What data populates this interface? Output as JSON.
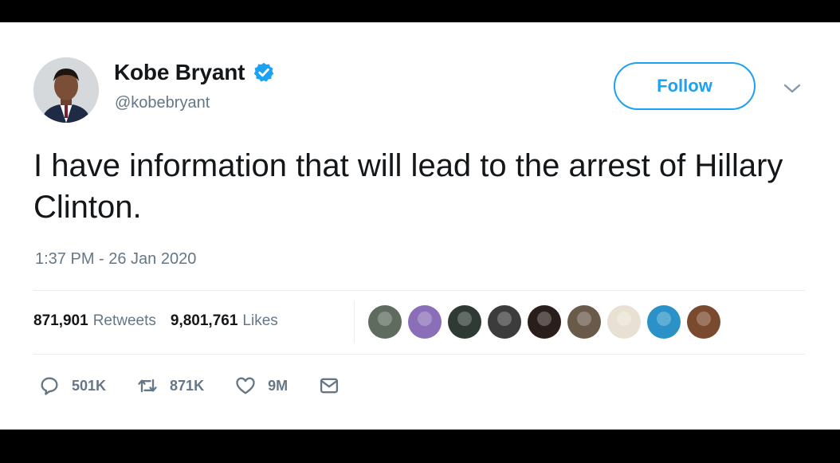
{
  "tweet": {
    "author": {
      "display_name": "Kobe Bryant",
      "handle": "@kobebryant",
      "verified": true
    },
    "follow_label": "Follow",
    "text": "I have information that will lead to the arrest of Hillary Clinton.",
    "timestamp": "1:37 PM - 26 Jan 2020",
    "stats": {
      "retweets_count": "871,901",
      "retweets_label": "Retweets",
      "likes_count": "9,801,761",
      "likes_label": "Likes"
    },
    "liker_avatar_colors": [
      "#5e6b5e",
      "#8a6fb8",
      "#2f3a34",
      "#3c3c3c",
      "#2a1e1c",
      "#6a5a4a",
      "#e9e0d4",
      "#2b92c8",
      "#7a4a2e"
    ],
    "actions": {
      "reply_count": "501K",
      "retweet_count": "871K",
      "like_count": "9M"
    }
  },
  "icons": {
    "verified": "verified-badge-icon",
    "chevron": "chevron-down-icon",
    "reply": "reply-bubble-icon",
    "retweet": "retweet-arrows-icon",
    "like": "heart-icon",
    "dm": "envelope-icon"
  },
  "colors": {
    "accent": "#1da1f2",
    "text_primary": "#14171a",
    "text_secondary": "#657786",
    "divider": "#e6ecf0"
  }
}
